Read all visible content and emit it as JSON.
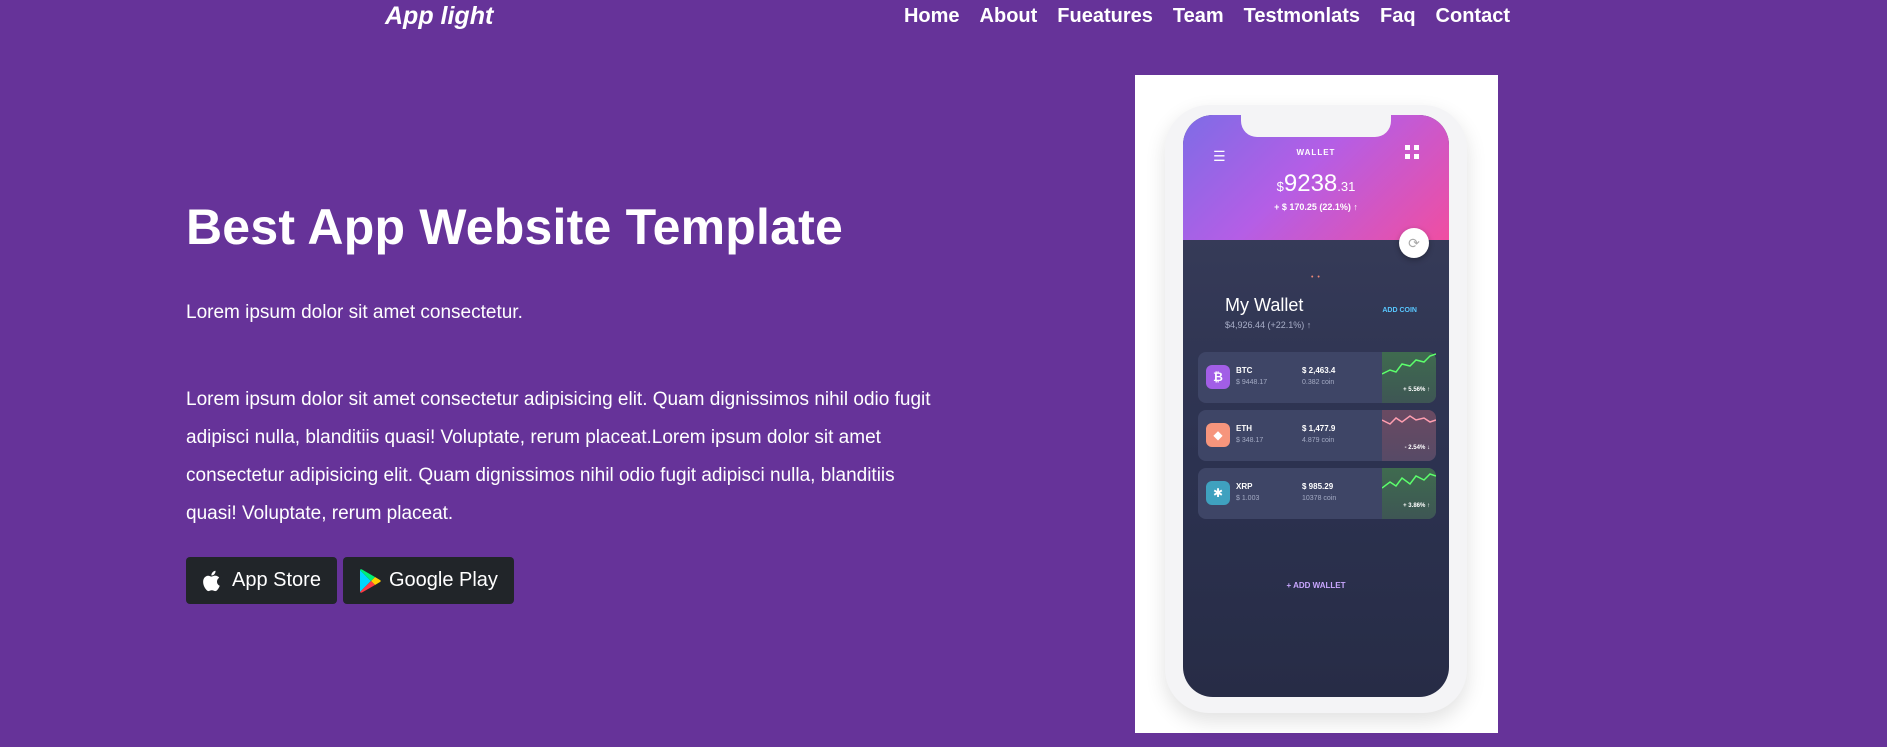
{
  "brand": {
    "logo": "App light"
  },
  "nav": {
    "home": "Home",
    "about": "About",
    "features": "Fueatures",
    "team": "Team",
    "testimonials": "Testmonlats",
    "faq": "Faq",
    "contact": "Contact"
  },
  "hero": {
    "title": "Best App Website Template",
    "lead": "Lorem ipsum dolor sit amet consectetur.",
    "body": "Lorem ipsum dolor sit amet consectetur adipisicing elit. Quam dignissimos nihil odio fugit adipisci nulla, blanditiis quasi! Voluptate, rerum placeat.Lorem ipsum dolor sit amet consectetur adipisicing elit. Quam dignissimos nihil odio fugit adipisci nulla, blanditiis quasi! Voluptate, rerum placeat.",
    "app_store_label": "App Store",
    "google_play_label": "Google Play"
  },
  "phone": {
    "wallet_label": "WALLET",
    "balance_currency": "$",
    "balance_main": "9238",
    "balance_cents": ".31",
    "balance_change": "+ $ 170.25 (22.1%) ↑",
    "my_wallet_title": "My Wallet",
    "my_wallet_sub": "$4,926.44 (+22.1%) ↑",
    "add_coin": "ADD COIN",
    "coins": [
      {
        "name": "BTC",
        "sub": "$ 9448.17",
        "value": "$ 2,463.4",
        "amount": "0.382 coin",
        "pct": "+ 5.56% ↑"
      },
      {
        "name": "ETH",
        "sub": "$ 348.17",
        "value": "$ 1,477.9",
        "amount": "4.879 coin",
        "pct": "- 2.54% ↓"
      },
      {
        "name": "XRP",
        "sub": "$ 1.003",
        "value": "$ 985.29",
        "amount": "10378 coin",
        "pct": "+ 3.86% ↑"
      }
    ],
    "add_wallet": "+ ADD WALLET"
  },
  "colors": {
    "background": "#663399",
    "button_bg": "#212529",
    "text": "#ffffff"
  }
}
